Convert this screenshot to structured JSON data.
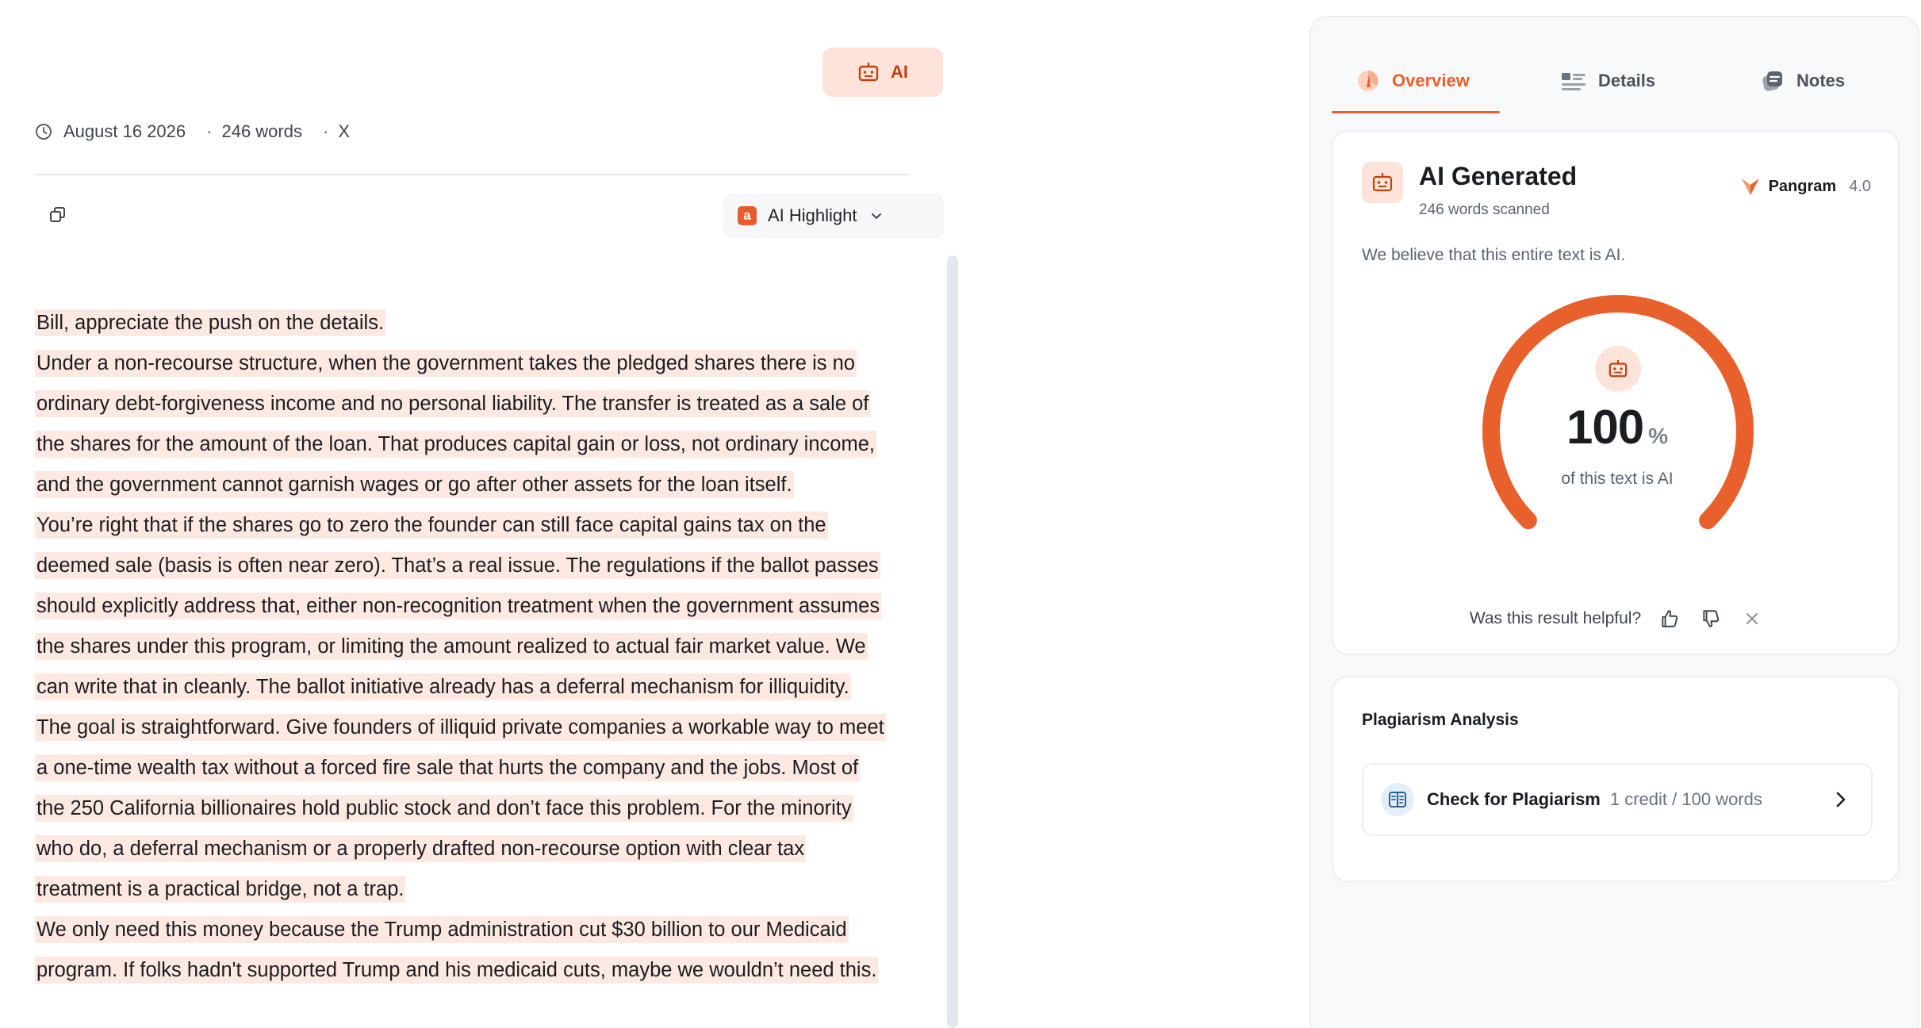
{
  "header": {
    "ai_badge_label": "AI",
    "date": "August 16 2026",
    "word_count": "246 words",
    "close_label": "X"
  },
  "toolbar": {
    "highlight_label": "AI Highlight",
    "highlight_icon_letter": "a"
  },
  "document": {
    "lines": [
      "Bill, appreciate the push on the details.",
      "Under a non-recourse structure, when the government takes the pledged shares there is no",
      "ordinary debt-forgiveness income and no personal liability. The transfer is treated as a sale of",
      "the shares for the amount of the loan. That produces capital gain or loss, not ordinary income,",
      "and the government cannot garnish wages or go after other assets for the loan itself.",
      "You’re right that if the shares go to zero the founder can still face capital gains tax on the",
      "deemed sale (basis is often near zero). That’s a real issue. The regulations if the ballot passes",
      "should explicitly address that, either non-recognition treatment when the government assumes",
      "the shares under this program, or limiting the amount realized to actual fair market value. We",
      "can write that in cleanly. The ballot initiative already has a deferral mechanism for illiquidity.",
      "The goal is straightforward. Give founders of illiquid private companies a workable way to meet",
      "a one-time wealth tax without a forced fire sale that hurts the company and the jobs. Most of",
      "the 250 California billionaires hold public stock and don’t face this problem. For the minority",
      "who do, a deferral mechanism or a properly drafted non-recourse option with clear tax",
      "treatment is a practical bridge, not a trap.",
      "We only need this money because the Trump administration cut $30 billion to our Medicaid",
      "program.  If folks hadn't supported Trump and his medicaid cuts, maybe we wouldn’t need this."
    ]
  },
  "panel": {
    "tabs": [
      {
        "label": "Overview",
        "icon": "overview-icon",
        "active": true
      },
      {
        "label": "Details",
        "icon": "details-icon",
        "active": false
      },
      {
        "label": "Notes",
        "icon": "notes-icon",
        "active": false
      }
    ],
    "result": {
      "title": "AI Generated",
      "scanned": "246 words scanned",
      "model_name": "Pangram",
      "model_version": "4.0",
      "summary": "We believe that this entire text is AI.",
      "percent_value": "100",
      "percent_sign": "%",
      "percent_fraction": 1.0,
      "caption": "of this text is AI",
      "feedback_prompt": "Was this result helpful?"
    },
    "plagiarism": {
      "title": "Plagiarism Analysis",
      "button_label": "Check for Plagiarism",
      "cost": "1 credit / 100 words"
    }
  },
  "colors": {
    "accent": "#e8602c",
    "highlight": "#fde8e2",
    "badge_bg": "#fde3da"
  }
}
